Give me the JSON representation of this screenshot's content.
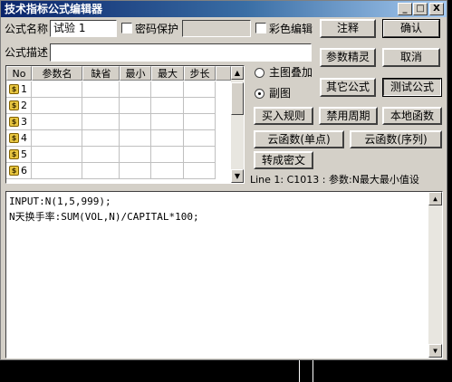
{
  "window": {
    "title": "技术指标公式编辑器"
  },
  "titlebar_buttons": {
    "minimize": "_",
    "maximize": "□",
    "close": "X"
  },
  "form": {
    "name_label": "公式名称",
    "name_value": "试验 1",
    "password_label": "密码保护",
    "color_label": "彩色编辑",
    "desc_label": "公式描述",
    "desc_value": ""
  },
  "param_table": {
    "headers": [
      "No",
      "参数名",
      "缺省",
      "最小",
      "最大",
      "步长"
    ],
    "rows": [
      "1",
      "2",
      "3",
      "4",
      "5",
      "6"
    ]
  },
  "right_buttons": {
    "comment": "注释",
    "confirm": "确认",
    "param_wizard": "参数精灵",
    "cancel": "取消",
    "other_formula": "其它公式",
    "test_formula": "测试公式"
  },
  "radio": {
    "main_overlay": "主图叠加",
    "sub_chart": "副图",
    "selected": "副图"
  },
  "action_buttons": {
    "buy_rule": "买入规则",
    "disable_period": "禁用周期",
    "local_function": "本地函数",
    "cloud_single": "云函数(单点)",
    "cloud_series": "云函数(序列)",
    "to_cipher": "转成密文"
  },
  "status": {
    "text": "Line 1: C1013 : 参数:N最大最小值设"
  },
  "editor": {
    "lines": [
      "INPUT:N(1,5,999);",
      "N天换手率:SUM(VOL,N)/CAPITAL*100;"
    ]
  }
}
